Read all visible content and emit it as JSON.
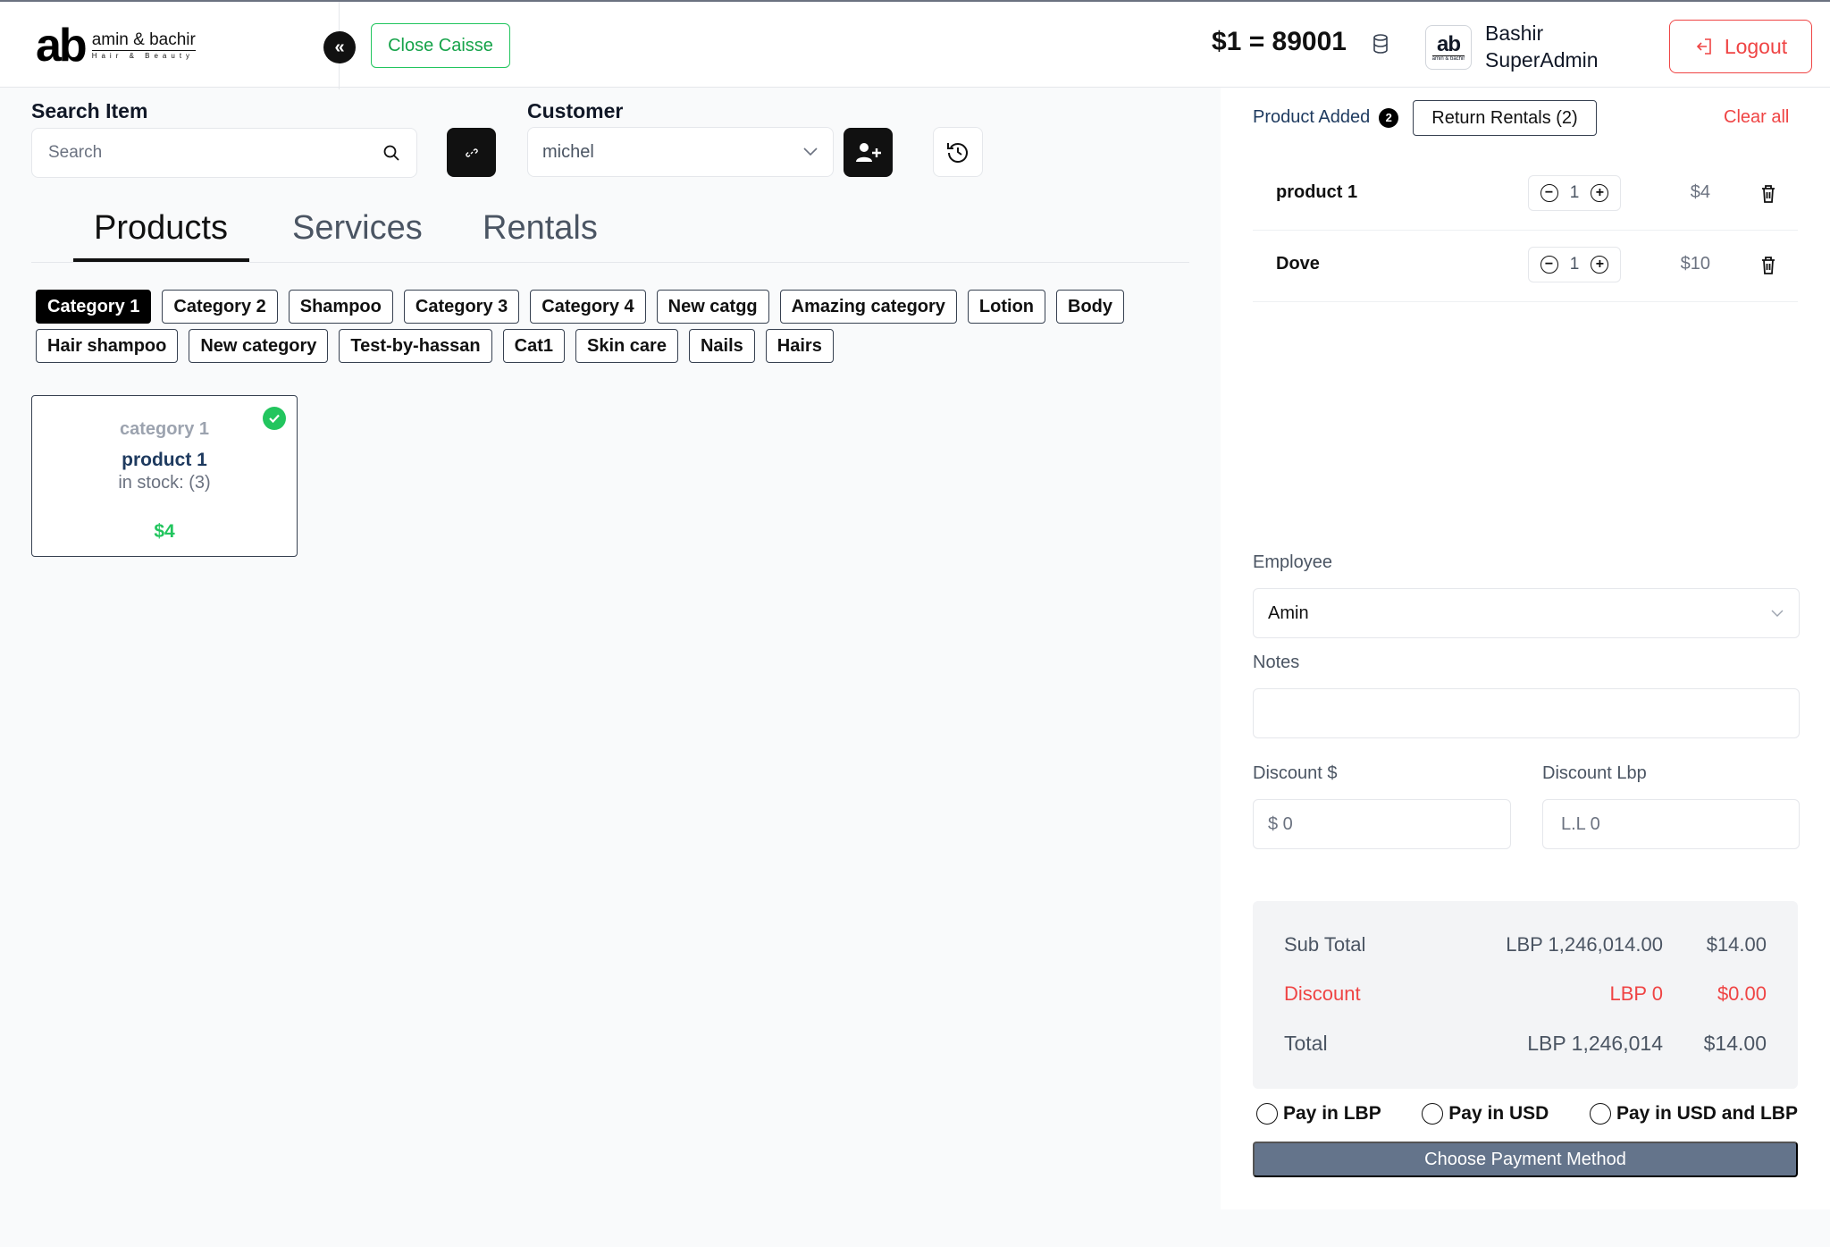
{
  "header": {
    "logo_mark": "ab",
    "logo_line1": "amin & bachir",
    "logo_line2": "Hair & Beauty",
    "collapse_icon": "«",
    "close_caisse": "Close Caisse",
    "rate": "$1 = 89001",
    "avatar_mark": "ab",
    "avatar_sub": "amin & bachir",
    "user_first": "Bashir",
    "user_role": "SuperAdmin",
    "logout": "Logout"
  },
  "search": {
    "label": "Search Item",
    "placeholder": "Search"
  },
  "customer": {
    "label": "Customer",
    "selected": "michel"
  },
  "tabs": [
    {
      "label": "Products",
      "active": true
    },
    {
      "label": "Services",
      "active": false
    },
    {
      "label": "Rentals",
      "active": false
    }
  ],
  "categories": [
    "Category 1",
    "Category 2",
    "Shampoo",
    "Category 3",
    "Category 4",
    "New catgg",
    "Amazing category",
    "Lotion",
    "Body",
    "Hair shampoo",
    "New category",
    "Test-by-hassan",
    "Cat1",
    "Skin care",
    "Nails",
    "Hairs"
  ],
  "product_card": {
    "category": "category 1",
    "name": "product 1",
    "stock": "in stock: (3)",
    "price": "$4"
  },
  "cart": {
    "title": "Product Added",
    "count": "2",
    "return_rentals": "Return Rentals (2)",
    "clear_all": "Clear all",
    "items": [
      {
        "name": "product 1",
        "qty": "1",
        "price": "$4"
      },
      {
        "name": "Dove",
        "qty": "1",
        "price": "$10"
      }
    ]
  },
  "form": {
    "employee_label": "Employee",
    "employee_value": "Amin",
    "notes_label": "Notes",
    "discount_usd_label": "Discount $",
    "discount_usd_placeholder": "$ 0",
    "discount_lbp_label": "Discount Lbp",
    "discount_lbp_placeholder": "L.L 0"
  },
  "totals": {
    "subtotal_label": "Sub Total",
    "subtotal_lbp": "LBP 1,246,014.00",
    "subtotal_usd": "$14.00",
    "discount_label": "Discount",
    "discount_lbp": "LBP 0",
    "discount_usd": "$0.00",
    "total_label": "Total",
    "total_lbp": "LBP 1,246,014",
    "total_usd": "$14.00"
  },
  "payment": {
    "options": [
      "Pay in LBP",
      "Pay in USD",
      "Pay in USD and LBP"
    ],
    "button": "Choose Payment Method"
  },
  "colors": {
    "accent_green": "#22c55e",
    "danger_red": "#ef4444",
    "pay_button": "#64748b"
  }
}
